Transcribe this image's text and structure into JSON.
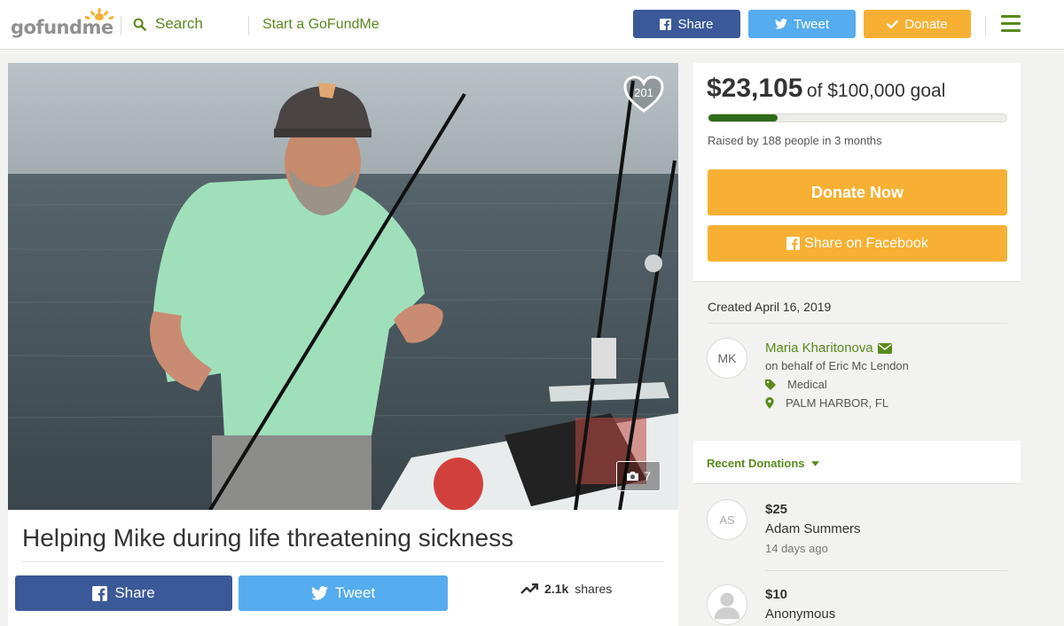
{
  "header": {
    "logo_text": "gofundme",
    "search_label": "Search",
    "start_label": "Start a GoFundMe",
    "share_label": "Share",
    "tweet_label": "Tweet",
    "donate_label": "Donate"
  },
  "campaign": {
    "heart_count": "201",
    "photo_count": "7",
    "title": "Helping Mike during life threatening sickness",
    "share_label": "Share",
    "tweet_label": "Tweet",
    "shares_count": "2.1k",
    "shares_label": "shares"
  },
  "goal": {
    "raised": "$23,105",
    "goal_text": "of $100,000 goal",
    "progress_fraction": 0.231,
    "raised_by": "Raised by 188 people in 3 months",
    "donate_now_label": "Donate Now",
    "share_facebook_label": "Share on Facebook"
  },
  "details": {
    "created": "Created April 16, 2019",
    "organizer_initials": "MK",
    "organizer_name": "Maria Kharitonova",
    "on_behalf": "on behalf of Eric Mc Lendon",
    "category": "Medical",
    "location": "PALM HARBOR, FL"
  },
  "donations": {
    "header": "Recent Donations",
    "items": [
      {
        "initials": "AS",
        "amount": "$25",
        "name": "Adam Summers",
        "time": "14 days ago"
      },
      {
        "initials": "",
        "amount": "$10",
        "name": "Anonymous",
        "time": ""
      }
    ]
  },
  "colors": {
    "brand_green": "#5a8a1c",
    "progress_green": "#2e6b19",
    "donate_orange": "#f7b033",
    "facebook_blue": "#3b5998",
    "twitter_blue": "#55acee"
  }
}
